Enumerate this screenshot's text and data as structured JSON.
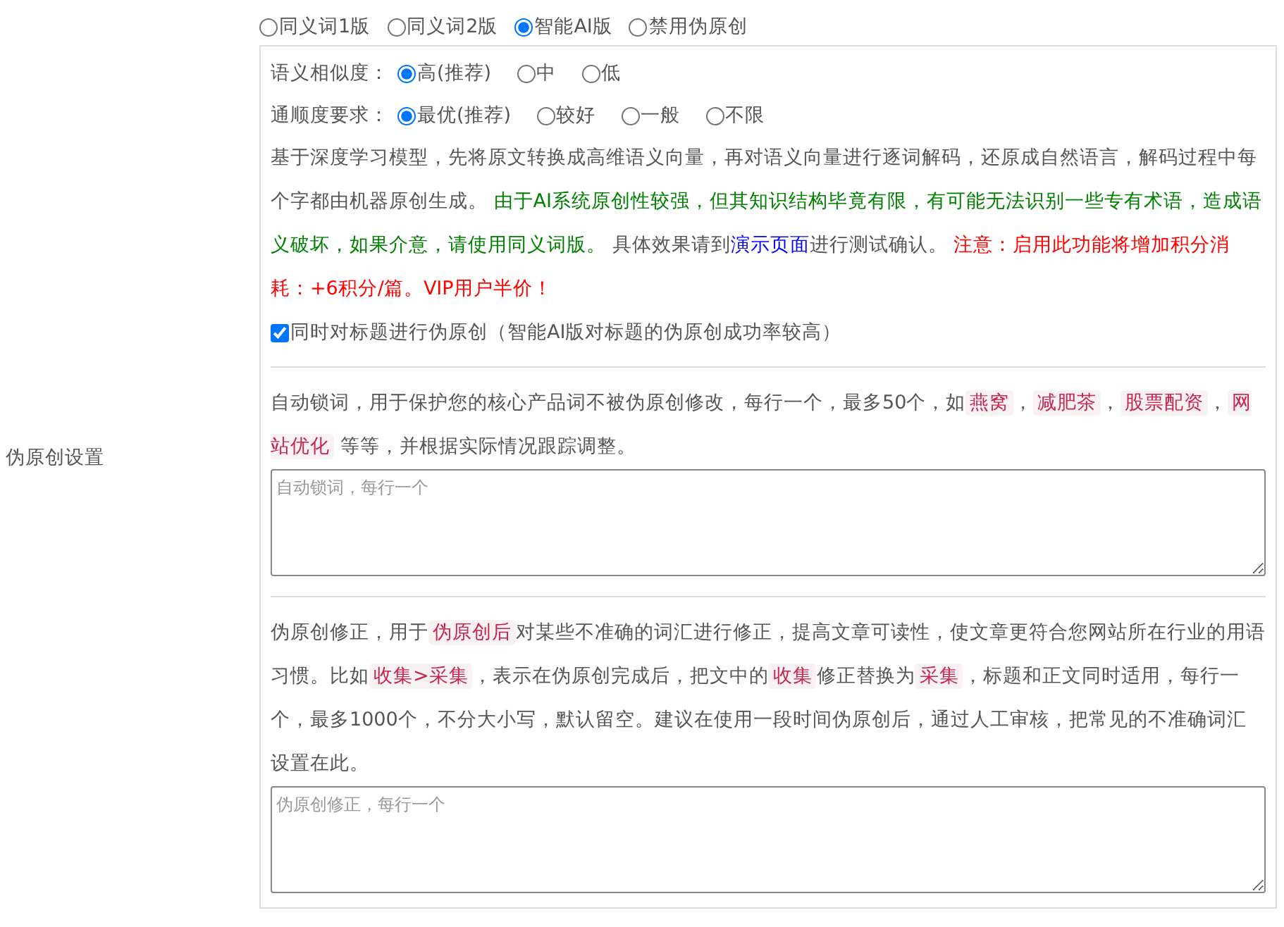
{
  "side_label": "伪原创设置",
  "modes": [
    {
      "label": "同义词1版",
      "selected": false
    },
    {
      "label": "同义词2版",
      "selected": false
    },
    {
      "label": "智能AI版",
      "selected": true
    },
    {
      "label": "禁用伪原创",
      "selected": false
    }
  ],
  "option_groups": [
    {
      "label": "语义相似度：",
      "options": [
        {
          "label": "高(推荐)",
          "selected": true
        },
        {
          "label": "中",
          "selected": false
        },
        {
          "label": "低",
          "selected": false
        }
      ]
    },
    {
      "label": "通顺度要求：",
      "options": [
        {
          "label": "最优(推荐)",
          "selected": true
        },
        {
          "label": "较好",
          "selected": false
        },
        {
          "label": "一般",
          "selected": false
        },
        {
          "label": "不限",
          "selected": false
        }
      ]
    }
  ],
  "ai_note": [
    {
      "kind": "text",
      "text": "基于深度学习模型，先将原文转换成高维语义向量，再对语义向量进行逐词解码，还原成自然语言，解码过程中每个字都由机器原创生成。 "
    },
    {
      "kind": "text",
      "text": "由于AI系统原创性较强，但其知识结构毕竟有限，有可能无法识别一些专有术语，造成语义破坏，如果介意，请使用同义词版。",
      "color": "#008000"
    },
    {
      "kind": "text",
      "text": " 具体效果请到"
    },
    {
      "kind": "link",
      "text": "演示页面"
    },
    {
      "kind": "text",
      "text": "进行测试确认。 "
    },
    {
      "kind": "text",
      "text": "注意：启用此功能将增加积分消耗：+6积分/篇。VIP用户半价！",
      "color": "#ff0000"
    }
  ],
  "title_option": {
    "label": "同时对标题进行伪原创（智能AI版对标题的伪原创成功率较高）",
    "checked": true
  },
  "lock_words": {
    "note": [
      {
        "kind": "text",
        "text": "自动锁词，用于保护您的核心产品词不被伪原创修改，每行一个，最多50个，如"
      },
      {
        "kind": "code",
        "text": "燕窝"
      },
      {
        "kind": "text",
        "text": "，"
      },
      {
        "kind": "code",
        "text": "减肥茶"
      },
      {
        "kind": "text",
        "text": "，"
      },
      {
        "kind": "code",
        "text": "股票配资"
      },
      {
        "kind": "text",
        "text": "，"
      },
      {
        "kind": "code",
        "text": "网站优化"
      },
      {
        "kind": "text",
        "text": " 等等，并根据实际情况跟踪调整。"
      }
    ],
    "placeholder": "自动锁词，每行一个"
  },
  "corrections": {
    "note": [
      {
        "kind": "text",
        "text": "伪原创修正，用于"
      },
      {
        "kind": "code",
        "text": "伪原创后"
      },
      {
        "kind": "text",
        "text": "对某些不准确的词汇进行修正，提高文章可读性，使文章更符合您网站所在行业的用语习惯。比如"
      },
      {
        "kind": "code",
        "text": "收集>采集"
      },
      {
        "kind": "text",
        "text": "，表示在伪原创完成后，把文中的"
      },
      {
        "kind": "code",
        "text": "收集"
      },
      {
        "kind": "text",
        "text": "修正替换为"
      },
      {
        "kind": "code",
        "text": "采集"
      },
      {
        "kind": "text",
        "text": "，标题和正文同时适用，每行一个，最多1000个，不分大小写，默认留空。建议在使用一段时间伪原创后，通过人工审核，把常见的不准确词汇设置在此。"
      }
    ],
    "placeholder": "伪原创修正，每行一个"
  }
}
